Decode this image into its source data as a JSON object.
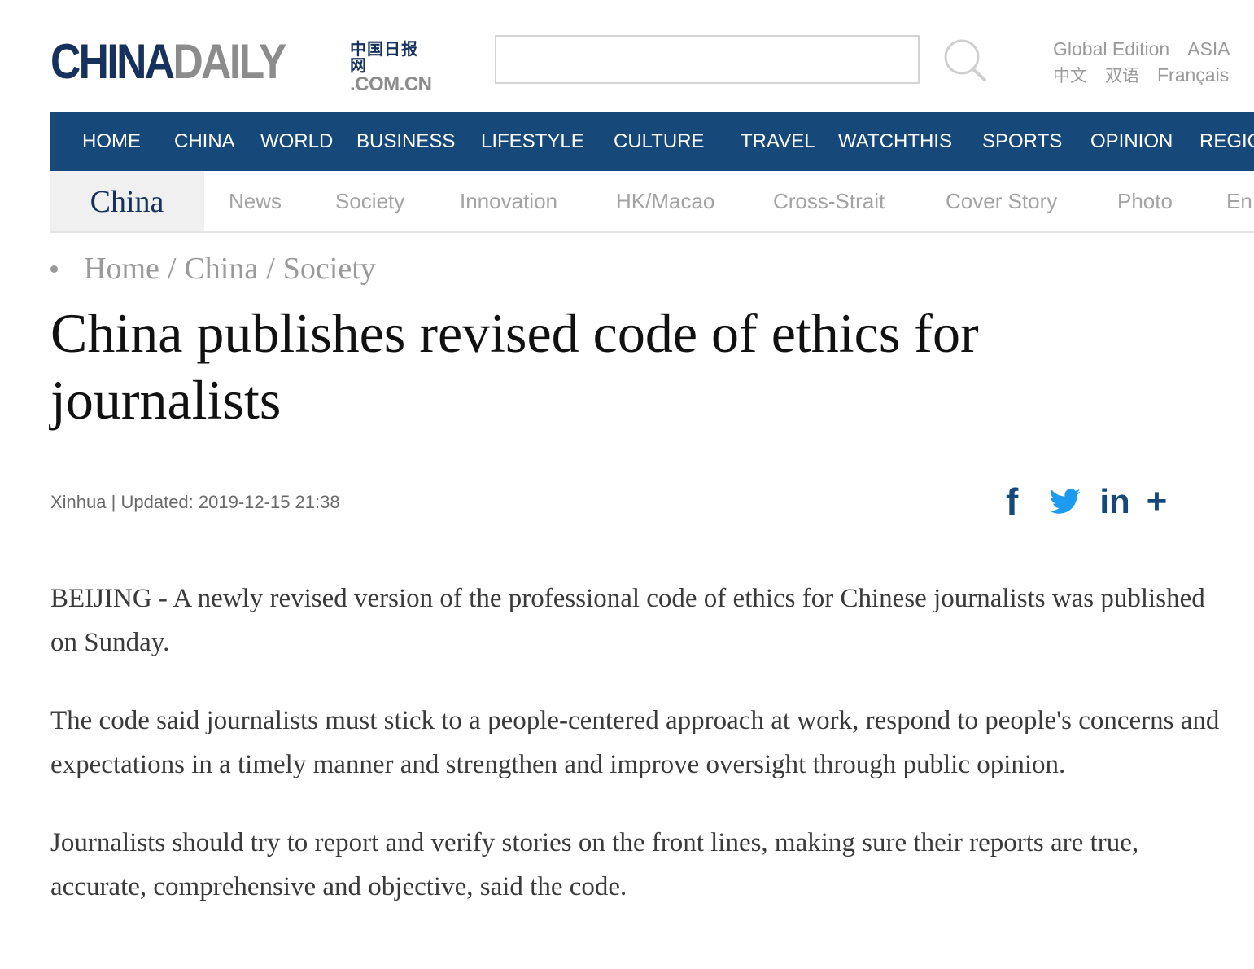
{
  "header": {
    "logo": {
      "china": "CHINA",
      "daily": "DAILY",
      "cn_text": "中国日报网",
      "domain": ".COM.CN"
    },
    "search": {
      "placeholder": "",
      "value": ""
    },
    "editions": {
      "row1": [
        "Global Edition",
        "ASIA"
      ],
      "row2": [
        "中文",
        "双语",
        "Français"
      ]
    }
  },
  "main_nav": {
    "items": [
      "HOME",
      "CHINA",
      "WORLD",
      "BUSINESS",
      "LIFESTYLE",
      "CULTURE",
      "TRAVEL",
      "WATCHTHIS",
      "SPORTS",
      "OPINION",
      "REGIO"
    ]
  },
  "sub_nav": {
    "section_title": "China",
    "items": [
      "News",
      "Society",
      "Innovation",
      "HK/Macao",
      "Cross-Strait",
      "Cover Story",
      "Photo",
      "En"
    ]
  },
  "breadcrumb": {
    "home": "Home",
    "separator": "/",
    "section": "China",
    "subsection": "Society"
  },
  "article": {
    "headline": "China publishes revised code of ethics for journalists",
    "source": "Xinhua",
    "updated_label": "Updated:",
    "updated_time": "2019-12-15 21:38",
    "byline_separator": "|",
    "paragraphs": [
      "BEIJING - A newly revised version of the professional code of ethics for Chinese journalists was published on Sunday.",
      "The code said journalists must stick to a people-centered approach at work, respond to people's concerns and expectations in a timely manner and strengthen and improve oversight through public opinion.",
      "Journalists should try to report and verify stories on the front lines, making sure their reports are true, accurate, comprehensive and objective, said the code."
    ]
  },
  "share": {
    "facebook": "f",
    "linkedin": "in",
    "more": "+"
  },
  "colors": {
    "brand_navy": "#16325c",
    "nav_blue": "#16497a",
    "logo_gray": "#8c8c8c",
    "muted_text": "#9a9a9a",
    "twitter_blue": "#1d9bf0"
  }
}
